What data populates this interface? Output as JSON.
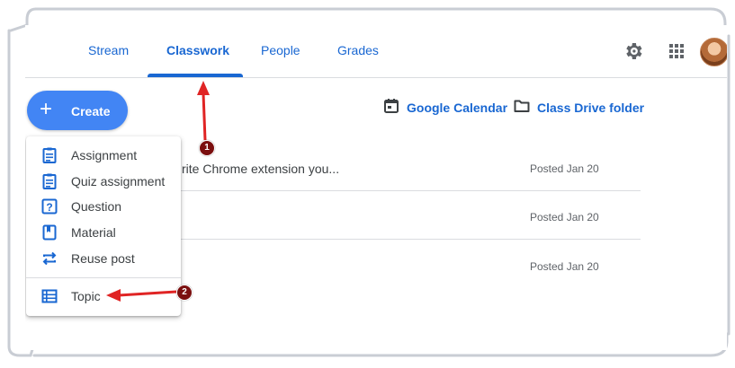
{
  "tabs": [
    {
      "label": "Stream"
    },
    {
      "label": "Classwork"
    },
    {
      "label": "People"
    },
    {
      "label": "Grades"
    }
  ],
  "header_icons": {
    "settings": "gear-icon",
    "apps": "apps-grid-icon",
    "account": "avatar"
  },
  "create_button": {
    "label": "Create",
    "icon": "plus-icon"
  },
  "top_links": [
    {
      "label": "Google Calendar",
      "icon": "calendar-icon"
    },
    {
      "label": "Class Drive folder",
      "icon": "folder-icon"
    }
  ],
  "posts": [
    {
      "title": "rite Chrome extension you...",
      "date": "Posted Jan 20"
    },
    {
      "title": "",
      "date": "Posted Jan 20"
    },
    {
      "title": "",
      "date": "Posted Jan 20"
    }
  ],
  "create_menu": {
    "items": [
      {
        "label": "Assignment",
        "icon": "assignment-icon"
      },
      {
        "label": "Quiz assignment",
        "icon": "quiz-assignment-icon"
      },
      {
        "label": "Question",
        "icon": "question-icon"
      },
      {
        "label": "Material",
        "icon": "material-icon"
      },
      {
        "label": "Reuse post",
        "icon": "reuse-post-icon"
      }
    ],
    "topic": {
      "label": "Topic",
      "icon": "topic-icon"
    }
  },
  "annotations": [
    {
      "label": "1"
    },
    {
      "label": "2"
    }
  ],
  "colors": {
    "accent": "#1967d2",
    "create": "#4285f4",
    "arrow": "#e02424",
    "badge": "#7b0f0f"
  }
}
